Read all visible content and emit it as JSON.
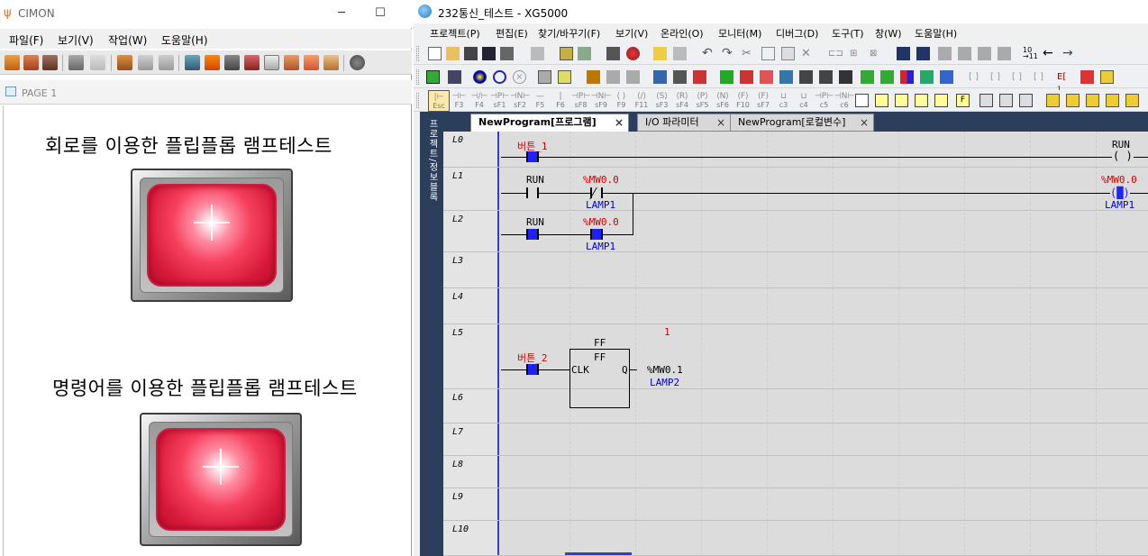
{
  "cimon": {
    "title": "CIMON",
    "menu": [
      "파일(F)",
      "보기(V)",
      "작업(W)",
      "도움말(H)"
    ],
    "page_tab": "PAGE 1",
    "lamp1_title": "회로를 이용한 플립플롭 램프테스트",
    "lamp2_title": "명령어를 이용한 플립플롭 램프테스트",
    "lamp_color": "#f6405e"
  },
  "xg5000": {
    "title": "232통신_테스트 - XG5000",
    "menu": [
      "프로젝트(P)",
      "편집(E)",
      "찾기/바꾸기(F)",
      "보기(V)",
      "온라인(O)",
      "모니터(M)",
      "디버그(D)",
      "도구(T)",
      "창(W)",
      "도움말(H)"
    ],
    "sidebar_label": "프로젝트/정보블록",
    "tabs": [
      "NewProgram[프로그램]",
      "I/O 파라미터",
      "NewProgram[로컬변수]"
    ],
    "fkeys": [
      {
        "sym": "|⊢",
        "key": "Esc"
      },
      {
        "sym": "⊣⊢",
        "key": "F3"
      },
      {
        "sym": "⊣/⊢",
        "key": "F4"
      },
      {
        "sym": "⊣P⊢",
        "key": "sF1"
      },
      {
        "sym": "⊣N⊢",
        "key": "sF2"
      },
      {
        "sym": "—",
        "key": "F5"
      },
      {
        "sym": "|",
        "key": "F6"
      },
      {
        "sym": "⊣P⊢",
        "key": "sF8"
      },
      {
        "sym": "⊣N⊢",
        "key": "sF9"
      },
      {
        "sym": "⟨ ⟩",
        "key": "F9"
      },
      {
        "sym": "⟨/⟩",
        "key": "F11"
      },
      {
        "sym": "⟨S⟩",
        "key": "sF3"
      },
      {
        "sym": "⟨R⟩",
        "key": "sF4"
      },
      {
        "sym": "⟨P⟩",
        "key": "sF5"
      },
      {
        "sym": "⟨N⟩",
        "key": "sF6"
      },
      {
        "sym": "⟨F⟩",
        "key": "F10"
      },
      {
        "sym": "⟨F⟩",
        "key": "sF7"
      },
      {
        "sym": "⊔",
        "key": "c3"
      },
      {
        "sym": "⊔",
        "key": "c4"
      },
      {
        "sym": "⊣P⊢",
        "key": "c5"
      },
      {
        "sym": "⊣N⊢",
        "key": "c6"
      }
    ],
    "rows": [
      "L0",
      "L1",
      "L2",
      "L3",
      "L4",
      "L5",
      "L6",
      "L7",
      "L8",
      "L9",
      "L10"
    ],
    "ladder": {
      "l0_contact": "버튼_1",
      "l0_coil": "RUN",
      "l1_contact": "RUN",
      "l1_nc": "%MW0.0",
      "l1_nc_comment": "LAMP1",
      "l1_coil": "%MW0.0",
      "l1_coil_comment": "LAMP1",
      "l2_contact": "RUN",
      "l2_no": "%MW0.0",
      "l2_no_comment": "LAMP1",
      "l5_contact": "버튼_2",
      "fb_name": "FF",
      "fb_type": "FF",
      "fb_in": "CLK",
      "fb_out": "Q",
      "fb_out_var": "%MW0.1",
      "fb_out_comment": "LAMP2",
      "fb_value": "1"
    }
  }
}
